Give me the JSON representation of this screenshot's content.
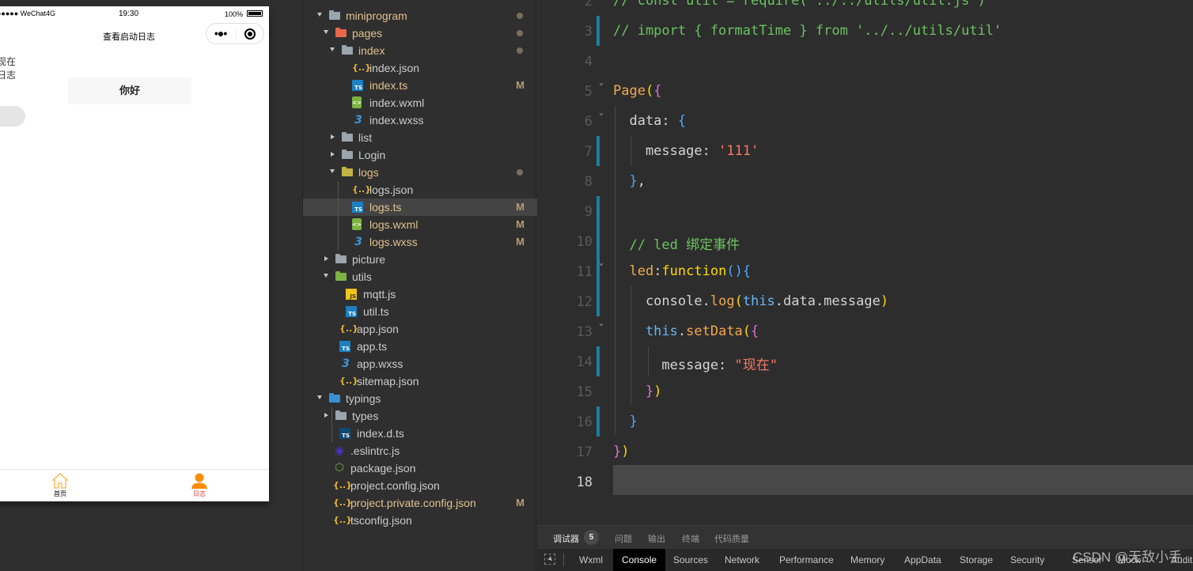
{
  "simulator": {
    "status_bar": {
      "carrier": "●●●●● WeChat4G",
      "time": "19:30",
      "battery": "100%"
    },
    "nav_title": "查看启动日志",
    "capsule": {
      "more": "•●•",
      "close": "record-icon"
    },
    "message_lines": [
      "现在",
      "日志"
    ],
    "hello_button": "你好",
    "toggle_on": false,
    "tab_bar": [
      {
        "label": "首页",
        "icon": "home-icon",
        "active": false
      },
      {
        "label": "日志",
        "icon": "user-icon",
        "active": true
      }
    ],
    "colors": {
      "tab_active": "#ff8c00",
      "tab_label_active": "#e03a3a"
    }
  },
  "explorer": {
    "items": [
      {
        "name": "miniprogram",
        "type": "folder",
        "depth": 0,
        "open": true,
        "status": "dot"
      },
      {
        "name": "pages",
        "type": "folder-pages",
        "depth": 1,
        "open": true,
        "status": "dot"
      },
      {
        "name": "index",
        "type": "folder",
        "depth": 2,
        "open": true,
        "status": "dot"
      },
      {
        "name": "index.json",
        "type": "json",
        "depth": 3,
        "status": ""
      },
      {
        "name": "index.ts",
        "type": "ts",
        "depth": 3,
        "status": "M"
      },
      {
        "name": "index.wxml",
        "type": "wxml",
        "depth": 3,
        "status": ""
      },
      {
        "name": "index.wxss",
        "type": "wxss",
        "depth": 3,
        "status": ""
      },
      {
        "name": "list",
        "type": "folder",
        "depth": 2,
        "open": false,
        "status": ""
      },
      {
        "name": "Login",
        "type": "folder",
        "depth": 2,
        "open": false,
        "status": ""
      },
      {
        "name": "logs",
        "type": "folder-logs",
        "depth": 2,
        "open": true,
        "status": "dot"
      },
      {
        "name": "logs.json",
        "type": "json",
        "depth": 3,
        "status": ""
      },
      {
        "name": "logs.ts",
        "type": "ts",
        "depth": 3,
        "status": "M",
        "selected": true
      },
      {
        "name": "logs.wxml",
        "type": "wxml",
        "depth": 3,
        "status": "M"
      },
      {
        "name": "logs.wxss",
        "type": "wxss",
        "depth": 3,
        "status": "M"
      },
      {
        "name": "picture",
        "type": "folder",
        "depth": 1,
        "open": false,
        "status": ""
      },
      {
        "name": "utils",
        "type": "folder-utils",
        "depth": 1,
        "open": true,
        "status": ""
      },
      {
        "name": "mqtt.js",
        "type": "js",
        "depth": 2,
        "status": ""
      },
      {
        "name": "util.ts",
        "type": "ts",
        "depth": 2,
        "status": ""
      },
      {
        "name": "app.json",
        "type": "json",
        "depth": 1,
        "status": ""
      },
      {
        "name": "app.ts",
        "type": "ts",
        "depth": 1,
        "status": ""
      },
      {
        "name": "app.wxss",
        "type": "wxss",
        "depth": 1,
        "status": ""
      },
      {
        "name": "sitemap.json",
        "type": "json",
        "depth": 1,
        "status": ""
      },
      {
        "name": "typings",
        "type": "folder-ts",
        "depth": 0,
        "open": true,
        "status": ""
      },
      {
        "name": "types",
        "type": "folder",
        "depth": 1,
        "open": false,
        "status": ""
      },
      {
        "name": "index.d.ts",
        "type": "dts",
        "depth": 1,
        "status": ""
      },
      {
        "name": ".eslintrc.js",
        "type": "eslint",
        "depth": 0,
        "status": ""
      },
      {
        "name": "package.json",
        "type": "node",
        "depth": 0,
        "status": ""
      },
      {
        "name": "project.config.json",
        "type": "json",
        "depth": 0,
        "status": ""
      },
      {
        "name": "project.private.config.json",
        "type": "json",
        "depth": 0,
        "status": "M"
      },
      {
        "name": "tsconfig.json",
        "type": "json",
        "depth": 0,
        "status": ""
      }
    ]
  },
  "editor": {
    "active_line": 18,
    "lines": [
      {
        "n": 2,
        "tokens": [
          [
            "comment",
            "// const util = require('../../utils/util.js')"
          ]
        ]
      },
      {
        "n": 3,
        "tokens": [
          [
            "comment",
            "// import { formatTime } from '../../utils/util'"
          ]
        ],
        "changed": true
      },
      {
        "n": 4,
        "tokens": []
      },
      {
        "n": 5,
        "tokens": [
          [
            "fn",
            "Page"
          ],
          [
            "paren1",
            "("
          ],
          [
            "brace1",
            "{"
          ]
        ],
        "fold": true
      },
      {
        "n": 6,
        "tokens": [
          [
            "key",
            "  data: "
          ],
          [
            "brace2",
            "{"
          ]
        ],
        "fold": true
      },
      {
        "n": 7,
        "tokens": [
          [
            "key",
            "    message: "
          ],
          [
            "str",
            "'111'"
          ]
        ],
        "changed": true
      },
      {
        "n": 8,
        "tokens": [
          [
            "brace2",
            "  }"
          ],
          [
            "key",
            ","
          ]
        ]
      },
      {
        "n": 9,
        "tokens": [],
        "changed": true
      },
      {
        "n": 10,
        "tokens": [
          [
            "comment",
            "  // led 绑定事件"
          ]
        ],
        "changed": true
      },
      {
        "n": 11,
        "tokens": [
          [
            "method",
            "  led"
          ],
          [
            "key",
            ":"
          ],
          [
            "paren1",
            "function"
          ],
          [
            "brace2",
            "(){"
          ]
        ],
        "fold": true,
        "changed": true
      },
      {
        "n": 12,
        "tokens": [
          [
            "prop",
            "    console"
          ],
          [
            "key",
            "."
          ],
          [
            "method",
            "log"
          ],
          [
            "paren1",
            "("
          ],
          [
            "kw",
            "this"
          ],
          [
            "key",
            ".data.message"
          ],
          [
            "paren1",
            ")"
          ]
        ],
        "changed": true
      },
      {
        "n": 13,
        "tokens": [
          [
            "kw",
            "    this"
          ],
          [
            "key",
            "."
          ],
          [
            "method",
            "setData"
          ],
          [
            "paren1",
            "("
          ],
          [
            "brace1",
            "{"
          ]
        ],
        "fold": true
      },
      {
        "n": 14,
        "tokens": [
          [
            "key",
            "      message: "
          ],
          [
            "str",
            "\"现在\""
          ]
        ],
        "changed": true
      },
      {
        "n": 15,
        "tokens": [
          [
            "brace1",
            "    }"
          ],
          [
            "paren1",
            ")"
          ]
        ]
      },
      {
        "n": 16,
        "tokens": [
          [
            "brace2",
            "  }"
          ]
        ],
        "changed": true
      },
      {
        "n": 17,
        "tokens": [
          [
            "brace1",
            "}"
          ],
          [
            "paren1",
            ")"
          ]
        ]
      },
      {
        "n": 18,
        "tokens": []
      }
    ]
  },
  "panel": {
    "tabs": [
      {
        "label": "调试器",
        "active": true,
        "count": "5"
      },
      {
        "label": "问题"
      },
      {
        "label": "输出"
      },
      {
        "label": "终端"
      },
      {
        "label": "代码质量"
      }
    ],
    "devtools_tabs": [
      "Wxml",
      "Console",
      "Sources",
      "Network",
      "Performance",
      "Memory",
      "AppData",
      "Storage",
      "Security",
      "Sensor",
      "Mock",
      "Audits"
    ],
    "devtools_active": "Console"
  },
  "watermark": "CSDN @无敌小手"
}
